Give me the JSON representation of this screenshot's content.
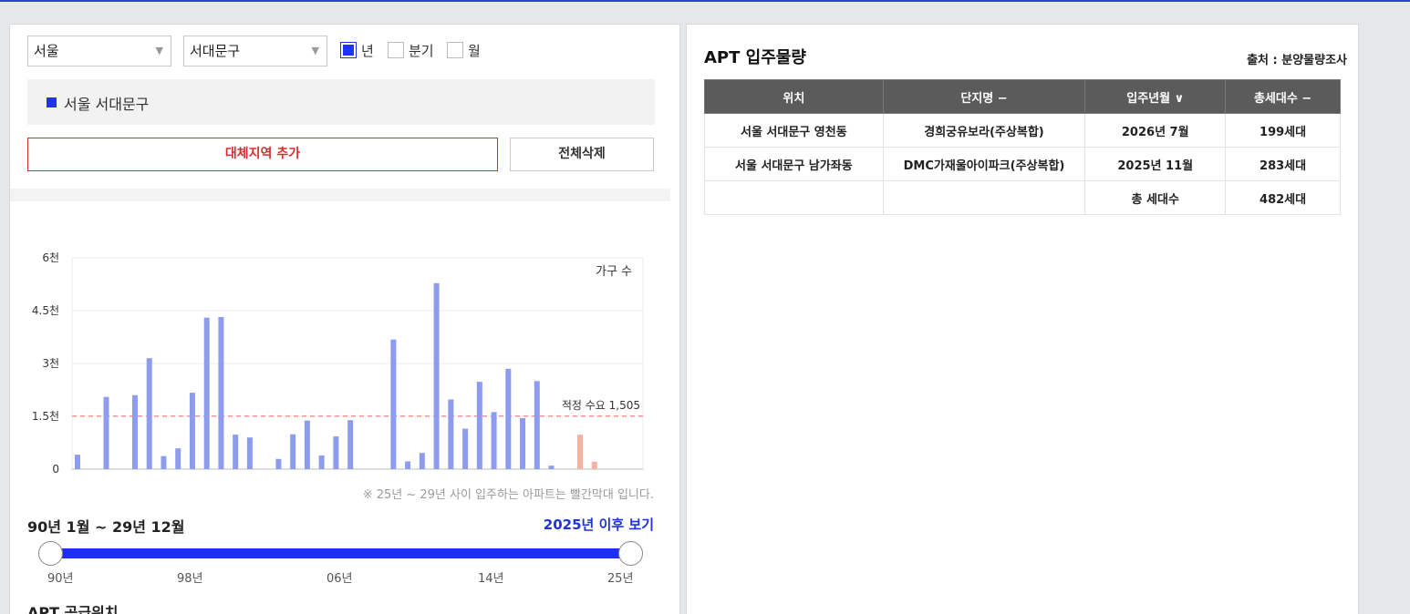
{
  "filters": {
    "city": "서울",
    "district": "서대문구",
    "periods": [
      {
        "label": "년",
        "checked": true
      },
      {
        "label": "분기",
        "checked": false
      },
      {
        "label": "월",
        "checked": false
      }
    ]
  },
  "selected_region": "서울 서대문구",
  "buttons": {
    "add_region": "대체지역 추가",
    "delete_all": "전체삭제"
  },
  "chart_data": {
    "type": "bar",
    "unit_label": "가구 수",
    "y_ticks": [
      "0",
      "1.5천",
      "3천",
      "4.5천",
      "6천"
    ],
    "ylim": [
      0,
      6000
    ],
    "x_ticks": [
      "1990",
      "1993",
      "1996",
      "1999",
      "2002",
      "2005",
      "2008",
      "2011",
      "2014",
      "2017",
      "2020",
      "2023",
      "2026",
      "2029"
    ],
    "xlim": [
      1990,
      2029
    ],
    "reference_line": {
      "label": "적정 수요 1,505",
      "value": 1505
    },
    "colors": {
      "past": "#8e9cf0",
      "future": "#f4b3a3",
      "reference": "#f08a8a"
    },
    "series": [
      {
        "name": "",
        "points": [
          [
            1990,
            410
          ],
          [
            1992,
            2050
          ],
          [
            1994,
            2100
          ],
          [
            1995,
            3150
          ],
          [
            1996,
            370
          ],
          [
            1997,
            590
          ],
          [
            1998,
            2170
          ],
          [
            1999,
            4300
          ],
          [
            2000,
            4320
          ],
          [
            2001,
            980
          ],
          [
            2002,
            900
          ],
          [
            2004,
            290
          ],
          [
            2005,
            990
          ],
          [
            2006,
            1380
          ],
          [
            2007,
            390
          ],
          [
            2008,
            930
          ],
          [
            2009,
            1390
          ],
          [
            2012,
            3680
          ],
          [
            2013,
            220
          ],
          [
            2014,
            460
          ],
          [
            2015,
            5280
          ],
          [
            2016,
            1980
          ],
          [
            2017,
            1150
          ],
          [
            2018,
            2480
          ],
          [
            2019,
            1620
          ],
          [
            2020,
            2850
          ],
          [
            2021,
            1450
          ],
          [
            2022,
            2500
          ],
          [
            2023,
            100
          ]
        ]
      },
      {
        "name": "",
        "points": [
          [
            2025,
            980
          ],
          [
            2026,
            210
          ]
        ]
      }
    ]
  },
  "chart_note": "※ 25년 ~ 29년 사이 입주하는 아파트는 빨간막대 입니다.",
  "range": {
    "title": "90년 1월 ~ 29년 12월",
    "after_link": "2025년 이후 보기",
    "ticks": [
      "90년",
      "98년",
      "06년",
      "14년",
      "25년"
    ]
  },
  "supply_title": "APT 공급위치",
  "right_panel": {
    "title": "APT 입주물량",
    "source": "출처 : 분양물량조사",
    "headers": [
      "위치",
      "단지명 −",
      "입주년월 ∨",
      "총세대수 −"
    ],
    "rows": [
      [
        "서울 서대문구 영천동",
        "경희궁유보라(주상복합)",
        "2026년 7월",
        "199세대"
      ],
      [
        "서울 서대문구 남가좌동",
        "DMC가재울아이파크(주상복합)",
        "2025년 11월",
        "283세대"
      ],
      [
        "",
        "",
        "총 세대수",
        "482세대"
      ]
    ]
  }
}
